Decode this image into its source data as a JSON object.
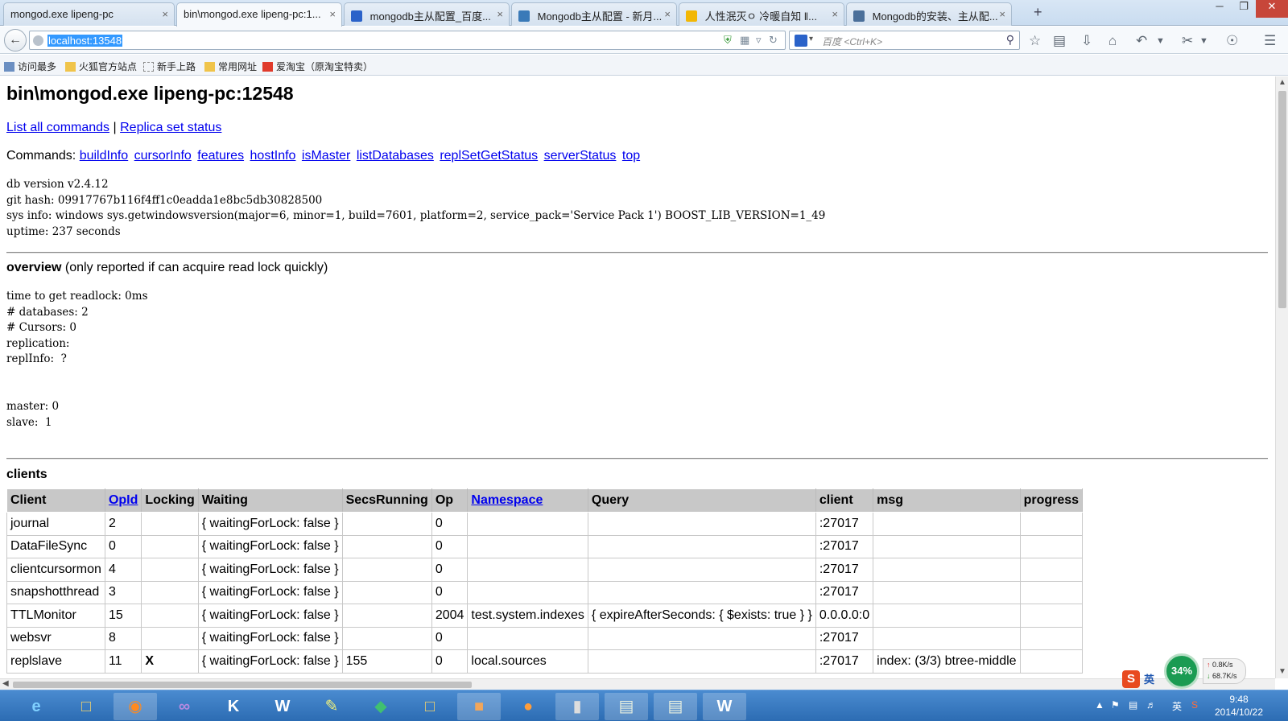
{
  "browser": {
    "tabs": [
      {
        "title": "mongod.exe lipeng-pc",
        "active": false
      },
      {
        "title": "bin\\mongod.exe lipeng-pc:1...",
        "active": true
      },
      {
        "title": "mongodb主从配置_百度...",
        "active": false
      },
      {
        "title": "Mongodb主从配置 - 新月...",
        "active": false
      },
      {
        "title": "人性泯灭ㅇ 冷暖自知 ‖...",
        "active": false
      },
      {
        "title": "Mongodb的安装、主从配...",
        "active": false
      }
    ],
    "new_tab": "+",
    "close_glyph": "×",
    "window_controls": [
      "─",
      "❐",
      "✕"
    ],
    "url": "localhost:13548",
    "search_placeholder": "百度 <Ctrl+K>",
    "bookmarks": [
      "访问最多",
      "火狐官方站点",
      "新手上路",
      "常用网址",
      "爱淘宝（原淘宝特卖）"
    ]
  },
  "page": {
    "title": "bin\\mongod.exe lipeng-pc:12548",
    "link_list_commands": "List all commands",
    "link_sep": "|",
    "link_replica": "Replica set status",
    "commands_label": "Commands:",
    "commands": [
      "buildInfo",
      "cursorInfo",
      "features",
      "hostInfo",
      "isMaster",
      "listDatabases",
      "replSetGetStatus",
      "serverStatus",
      "top"
    ],
    "info_block": "db version v2.4.12\ngit hash: 09917767b116f4ff1c0eadda1e8bc5db30828500\nsys info: windows sys.getwindowsversion(major=6, minor=1, build=7601, platform=2, service_pack='Service Pack 1') BOOST_LIB_VERSION=1_49\nuptime: 237 seconds",
    "overview_bold": "overview",
    "overview_rest": " (only reported if can acquire read lock quickly)",
    "overview_block": "time to get readlock: 0ms\n# databases: 2\n# Cursors: 0\nreplication:\nreplInfo:  ?\n\n\nmaster: 0\nslave:  1",
    "clients_heading": "clients",
    "table": {
      "headers": [
        "Client",
        "OpId",
        "Locking",
        "Waiting",
        "SecsRunning",
        "Op",
        "Namespace",
        "Query",
        "client",
        "msg",
        "progress"
      ],
      "rows": [
        [
          "journal",
          "2",
          "",
          "{ waitingForLock: false }",
          "",
          "0",
          "",
          "",
          ":27017",
          "",
          ""
        ],
        [
          "DataFileSync",
          "0",
          "",
          "{ waitingForLock: false }",
          "",
          "0",
          "",
          "",
          ":27017",
          "",
          ""
        ],
        [
          "clientcursormon",
          "4",
          "",
          "{ waitingForLock: false }",
          "",
          "0",
          "",
          "",
          ":27017",
          "",
          ""
        ],
        [
          "snapshotthread",
          "3",
          "",
          "{ waitingForLock: false }",
          "",
          "0",
          "",
          "",
          ":27017",
          "",
          ""
        ],
        [
          "TTLMonitor",
          "15",
          "",
          "{ waitingForLock: false }",
          "",
          "2004",
          "test.system.indexes",
          "{ expireAfterSeconds: { $exists: true } }",
          "0.0.0.0:0",
          "",
          ""
        ],
        [
          "websvr",
          "8",
          "",
          "{ waitingForLock: false }",
          "",
          "0",
          "",
          "",
          ":27017",
          "",
          ""
        ],
        [
          "replslave",
          "11",
          "X",
          "{ waitingForLock: false }",
          "155",
          "0",
          "local.sources",
          "",
          ":27017",
          "index: (3/3) btree-middle",
          ""
        ]
      ]
    }
  },
  "taskbar": {
    "apps": [
      "ie-icon",
      "explorer-icon",
      "firefox-icon",
      "visual-studio-icon",
      "k-app-icon",
      "word-w-icon",
      "paint-icon",
      "green-app-icon",
      "folder-icon",
      "photo-icon",
      "pdf-icon",
      "cmd-icon",
      "reader-icon",
      "reader-icon-2",
      "word-icon"
    ],
    "time": "9:48",
    "date": "2014/10/22",
    "ime_lang": "英",
    "net_percent": "34%",
    "net_up": "0.8K/s",
    "net_down": "68.7K/s"
  }
}
